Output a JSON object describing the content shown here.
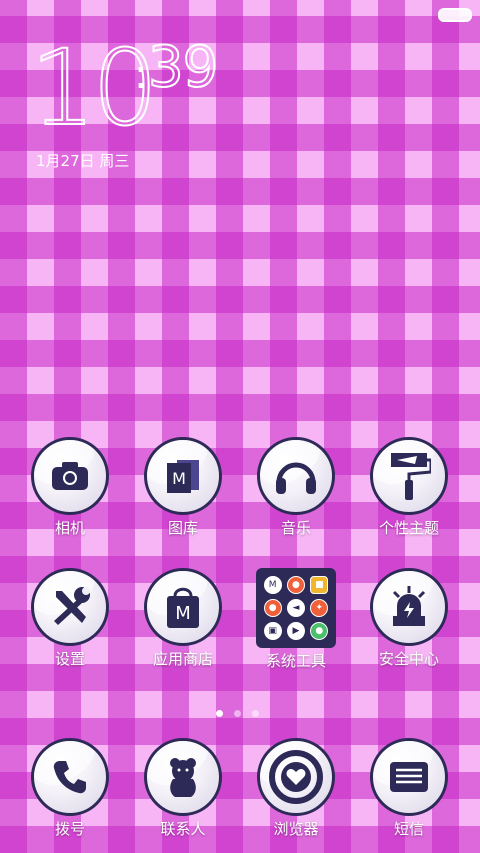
{
  "clock": {
    "hours": "10",
    "minutes": "39",
    "date": "1月27日 周三"
  },
  "apps_row1": [
    {
      "label": "相机",
      "icon": "camera-icon"
    },
    {
      "label": "图库",
      "icon": "gallery-icon"
    },
    {
      "label": "音乐",
      "icon": "headphones-icon"
    },
    {
      "label": "个性主题",
      "icon": "paint-roller-icon"
    }
  ],
  "apps_row2": [
    {
      "label": "设置",
      "icon": "tools-icon"
    },
    {
      "label": "应用商店",
      "icon": "shopping-bag-icon"
    },
    {
      "label": "系统工具",
      "icon": "folder-icon"
    },
    {
      "label": "安全中心",
      "icon": "security-alarm-icon"
    }
  ],
  "dock": [
    {
      "label": "拨号",
      "icon": "phone-icon"
    },
    {
      "label": "联系人",
      "icon": "contacts-bear-icon"
    },
    {
      "label": "浏览器",
      "icon": "browser-heart-icon"
    },
    {
      "label": "短信",
      "icon": "message-icon"
    }
  ],
  "folder_letter": "M",
  "colors": {
    "accent": "#2e2a58",
    "pink_light": "#f7b5f5",
    "pink_dark": "#c628c6"
  },
  "page_indicator": {
    "pages": 3,
    "active": 1
  }
}
